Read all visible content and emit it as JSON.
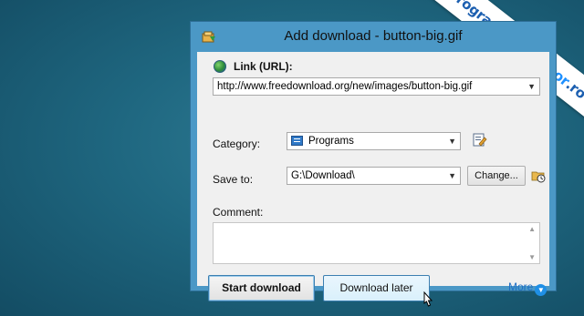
{
  "watermark": {
    "part1": "programe",
    "part2": "calculator",
    "part3": ".ro"
  },
  "window": {
    "title": "Add download - button-big.gif"
  },
  "link": {
    "label": "Link (URL):",
    "value": "http://www.freedownload.org/new/images/button-big.gif"
  },
  "category": {
    "label": "Category:",
    "value": "Programs"
  },
  "save_to": {
    "label": "Save to:",
    "value": "G:\\Download\\",
    "change_label": "Change..."
  },
  "comment": {
    "label": "Comment:",
    "value": ""
  },
  "actions": {
    "start": "Start download",
    "later": "Download later",
    "more": "More"
  },
  "icons": {
    "app": "download-manager-icon",
    "link": "globe-icon",
    "category_edit": "edit-category-icon",
    "save_browse": "folder-clock-icon",
    "more": "chevron-down-icon",
    "cursor": "mouse-cursor-icon"
  },
  "colors": {
    "desktop": "#1f6780",
    "titlebar": "#4b98c6",
    "accent_link": "#1f6fc4"
  }
}
